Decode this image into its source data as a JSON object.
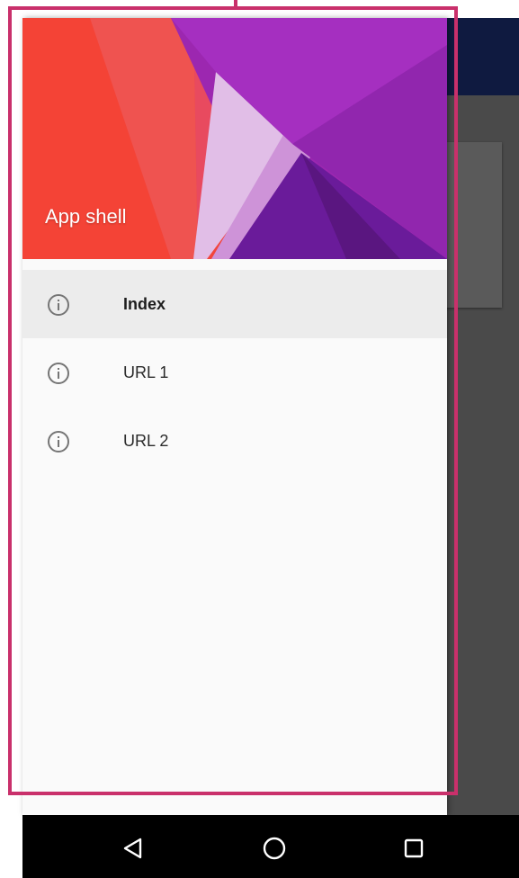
{
  "drawer": {
    "title": "App shell",
    "items": [
      {
        "label": "Index",
        "icon": "info-outline-icon",
        "active": true
      },
      {
        "label": "URL 1",
        "icon": "info-outline-icon",
        "active": false
      },
      {
        "label": "URL 2",
        "icon": "info-outline-icon",
        "active": false
      }
    ]
  },
  "navbar": {
    "buttons": [
      {
        "icon": "back-triangle-icon"
      },
      {
        "icon": "home-circle-icon"
      },
      {
        "icon": "recents-square-icon"
      }
    ]
  },
  "colors": {
    "highlight": "#c9306b",
    "toolbar": "#0f1a40",
    "header_red": "#f44336",
    "header_purple": "#9c27b0",
    "drawer_bg": "#fafafa",
    "active_item_bg": "#ececec"
  }
}
